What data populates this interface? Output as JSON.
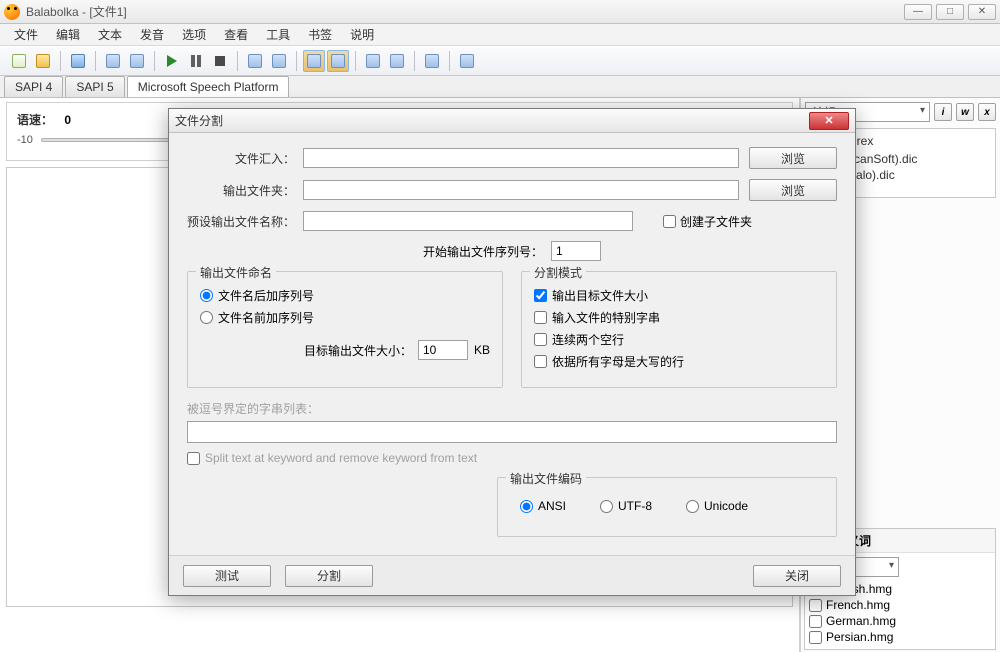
{
  "window": {
    "title": "Balabolka - [文件1]",
    "controls": {
      "min": "—",
      "max": "□",
      "close": "✕"
    }
  },
  "menu": [
    "文件",
    "编辑",
    "文本",
    "发音",
    "选项",
    "查看",
    "工具",
    "书签",
    "说明"
  ],
  "tabs": [
    "SAPI 4",
    "SAPI 5",
    "Microsoft Speech Platform"
  ],
  "selectedTab": 2,
  "speed": {
    "label": "语速：",
    "value": "0",
    "min": "-10"
  },
  "rightPanel": {
    "editLabel": "编辑",
    "miniButtons": [
      "i",
      "w",
      "x"
    ],
    "files": [
      "n (L&H).rex",
      "",
      "erina (ScanSoft).dic",
      "olai (Digalo).dic"
    ],
    "homoTitle": "同形异义词",
    "hmgItems": [
      "English.hmg",
      "French.hmg",
      "German.hmg",
      "Persian.hmg"
    ]
  },
  "dialog": {
    "title": "文件分割",
    "rows": {
      "importLabel": "文件汇入：",
      "browse": "浏览",
      "outFolderLabel": "输出文件夹：",
      "presetNameLabel": "预设输出文件名称：",
      "createSubfolder": "创建子文件夹",
      "startSeqLabel": "开始输出文件序列号：",
      "startSeqValue": "1"
    },
    "naming": {
      "legend": "输出文件命名",
      "optAfter": "文件名后加序列号",
      "optBefore": "文件名前加序列号",
      "targetSizeLabel": "目标输出文件大小：",
      "targetSizeValue": "10",
      "targetSizeUnit": "KB"
    },
    "splitMode": {
      "legend": "分割模式",
      "opt1": "输出目标文件大小",
      "opt2": "输入文件的特别字串",
      "opt3": "连续两个空行",
      "opt4": "依据所有字母是大写的行"
    },
    "delimLabel": "被逗号界定的字串列表：",
    "splitKeyword": "Split text at keyword and remove keyword from text",
    "encoding": {
      "legend": "输出文件编码",
      "ansi": "ANSI",
      "utf8": "UTF-8",
      "unicode": "Unicode"
    },
    "buttons": {
      "test": "测试",
      "split": "分割",
      "close": "关闭"
    }
  }
}
